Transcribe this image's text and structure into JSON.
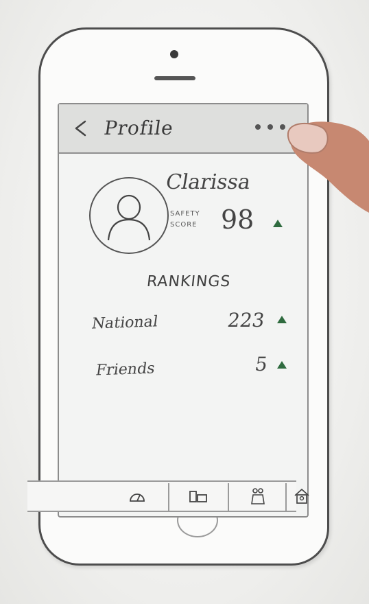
{
  "header": {
    "title": "Profile",
    "back_icon": "chevron-left-icon",
    "more_icon": "ellipsis-icon"
  },
  "profile": {
    "name": "Clarissa",
    "safety_label_line1": "SAFETY",
    "safety_label_line2": "SCORE",
    "safety_score": "98",
    "safety_trend": "up"
  },
  "rankings": {
    "heading": "RANKINGS",
    "items": [
      {
        "label": "National",
        "value": "223",
        "trend": "up"
      },
      {
        "label": "Friends",
        "value": "5",
        "trend": "up"
      }
    ]
  },
  "tabs": [
    {
      "icon": "gauge-icon"
    },
    {
      "icon": "vehicle-icon"
    },
    {
      "icon": "friends-icon"
    },
    {
      "icon": "home-icon"
    }
  ],
  "colors": {
    "trend_up": "#2f6b3f",
    "sketch_ink": "#444444",
    "header_bg": "#dedfdd"
  }
}
